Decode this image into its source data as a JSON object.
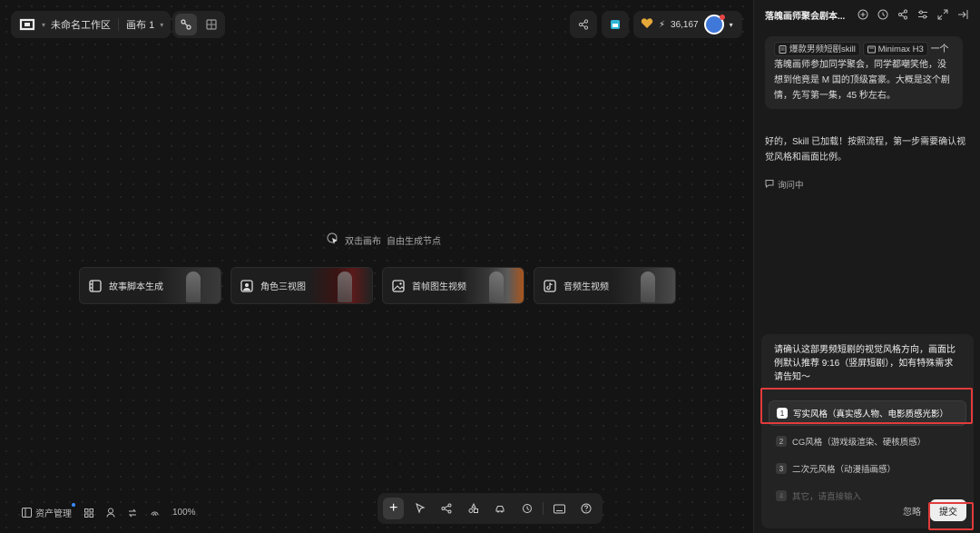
{
  "header": {
    "workspace_name": "未命名工作区",
    "canvas_name": "画布 1"
  },
  "credits": {
    "value": "36,167"
  },
  "canvas": {
    "hint_primary": "双击画布",
    "hint_secondary": "自由生成节点",
    "cards": [
      {
        "label": "故事脚本生成",
        "icon": "storyboard-icon"
      },
      {
        "label": "角色三视图",
        "icon": "portrait-icon"
      },
      {
        "label": "首帧图生视频",
        "icon": "image-icon"
      },
      {
        "label": "音频生视频",
        "icon": "tiktok-icon"
      }
    ]
  },
  "bottom_left": {
    "assets_label": "资产管理",
    "zoom": "100%"
  },
  "panel": {
    "title": "落魄画师聚会剧本...",
    "user_message": {
      "chip1": "爆款男频短剧skill",
      "chip2": "Minimax H3",
      "text": "一个落魄画师参加同学聚会，同学都嘲笑他，没想到他竟是 M 国的顶级富豪。大概是这个剧情，先写第一集，45 秒左右。"
    },
    "ai_message": "好的，Skill 已加载！按照流程，第一步需要确认视觉风格和画面比例。",
    "asking_label": "询问中",
    "question": {
      "text": "请确认这部男频短剧的视觉风格方向，画面比例默认推荐 9:16（竖屏短剧），如有特殊需求请告知～",
      "options": [
        {
          "num": "1",
          "label": "写实风格（真实感人物、电影质感光影）"
        },
        {
          "num": "2",
          "label": "CG风格（游戏级渲染、硬核质感）"
        },
        {
          "num": "3",
          "label": "二次元风格（动漫插画感）"
        },
        {
          "num": "4",
          "label": "其它，请直接输入"
        }
      ],
      "ignore_label": "忽略",
      "submit_label": "提交"
    }
  },
  "colors": {
    "background": "#141414",
    "panel": "#1a1a1a",
    "highlight": "#e23b3b",
    "avatar": "#3f78d8"
  }
}
